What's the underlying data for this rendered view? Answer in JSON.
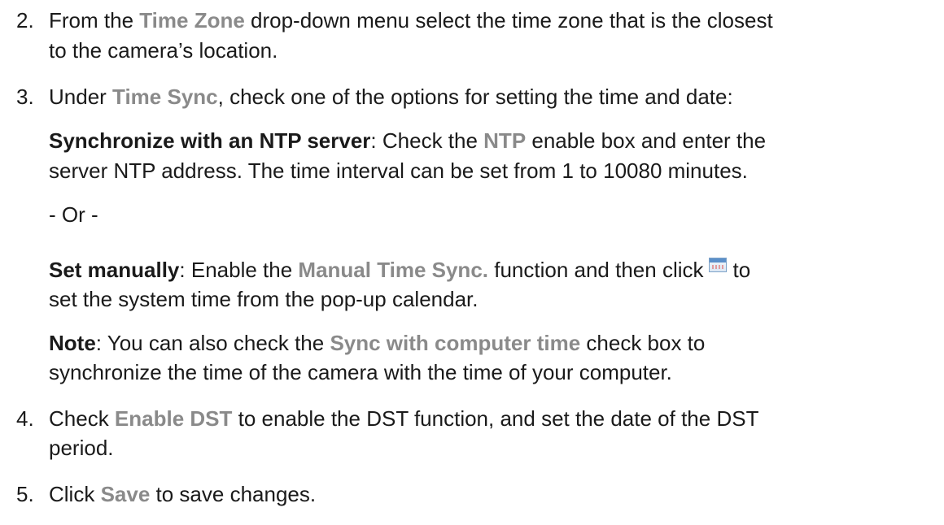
{
  "steps": {
    "s2": {
      "num": "2.",
      "pre": "From the ",
      "ui": "Time Zone",
      "post": " drop-down menu select the time zone that is the closest",
      "line2": "to the camera’s location."
    },
    "s3": {
      "num": "3.",
      "pre": "Under ",
      "ui": "Time Sync",
      "post": ", check one of the options for setting the time and date:"
    },
    "ntp": {
      "bold": "Synchronize with an NTP server",
      "pre": ": Check the ",
      "ui": "NTP",
      "post": " enable box and enter the",
      "line2": "server NTP address. The time interval can be set from 1 to 10080 minutes."
    },
    "or_text": "- Or -",
    "manual": {
      "bold": "Set manually",
      "pre": ": Enable the ",
      "ui": "Manual Time Sync.",
      "post": " function and then click",
      "after_icon": "to",
      "line2": "set the system time from the pop-up calendar.",
      "icon": "calendar-icon"
    },
    "note": {
      "bold": "Note",
      "pre": ": You can also check the ",
      "ui": "Sync with computer time",
      "post": " check box to",
      "line2": "synchronize the time of the camera with the time of your computer."
    },
    "s4": {
      "num": "4.",
      "pre": "Check ",
      "ui": "Enable DST",
      "post": " to enable the DST function, and set the date of the DST",
      "line2": "period."
    },
    "s5": {
      "num": "5.",
      "pre": "Click ",
      "ui": "Save",
      "post": " to save changes."
    }
  }
}
